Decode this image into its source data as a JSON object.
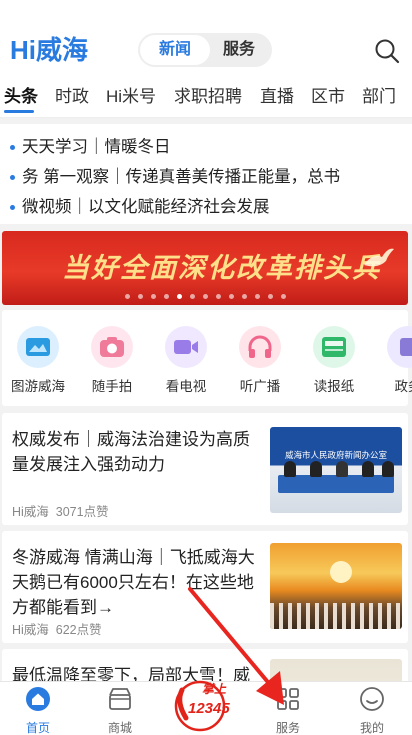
{
  "header": {
    "logo": "Hi威海",
    "segments": [
      "新闻",
      "服务"
    ],
    "active_segment": "新闻"
  },
  "tabs": [
    "头条",
    "时政",
    "Hi米号",
    "求职招聘",
    "直播",
    "区市",
    "部门"
  ],
  "headlines": [
    "天天学习｜情暖冬日",
    "务          第一观察｜传递真善美传播正能量，总书",
    "微视频｜以文化赋能经济社会发展"
  ],
  "banner": {
    "title": "当好全面深化改革排头兵",
    "slides": 13,
    "active_slide": 4
  },
  "quick_links": [
    {
      "label": "图游威海",
      "icon": "map-icon",
      "color": "#2a9be0"
    },
    {
      "label": "随手拍",
      "icon": "camera-icon",
      "color": "#f07a9a"
    },
    {
      "label": "看电视",
      "icon": "video-icon",
      "color": "#9a7ce8"
    },
    {
      "label": "听广播",
      "icon": "headphones-icon",
      "color": "#f0668a"
    },
    {
      "label": "读报纸",
      "icon": "newspaper-icon",
      "color": "#2fb86a"
    },
    {
      "label": "政务",
      "icon": "gov-icon",
      "color": "#8a7ad8"
    }
  ],
  "news": [
    {
      "title": "权威发布｜威海法治建设为高质量发展注入强劲动力",
      "source": "Hi威海",
      "likes": "3071点赞",
      "image": "press-conference-image",
      "image_caption": "威海市人民政府新闻办公室"
    },
    {
      "title": "冬游威海 情满山海｜飞抵威海大天鹅已有6000只左右！在这些地方都能看到→",
      "source": "Hi威海",
      "likes": "622点赞",
      "image": "swans-sunset-image"
    },
    {
      "title": "最低温降至零下，局部大雪！威",
      "image": "snow-image"
    }
  ],
  "bottom_nav": [
    {
      "label": "首页",
      "icon": "home-icon",
      "active": true
    },
    {
      "label": "商城",
      "icon": "shop-icon",
      "active": false
    },
    {
      "label": "掌上12345",
      "icon": "hotline-icon",
      "active": false
    },
    {
      "label": "服务",
      "icon": "grid-icon",
      "active": false
    },
    {
      "label": "我的",
      "icon": "user-icon",
      "active": false
    }
  ],
  "hotline": {
    "top": "掌上",
    "number": "12345"
  },
  "colors": {
    "accent": "#2a7be0",
    "banner_red": "#d8291f",
    "banner_text": "#ffe08a",
    "arrow": "#e8251f"
  }
}
